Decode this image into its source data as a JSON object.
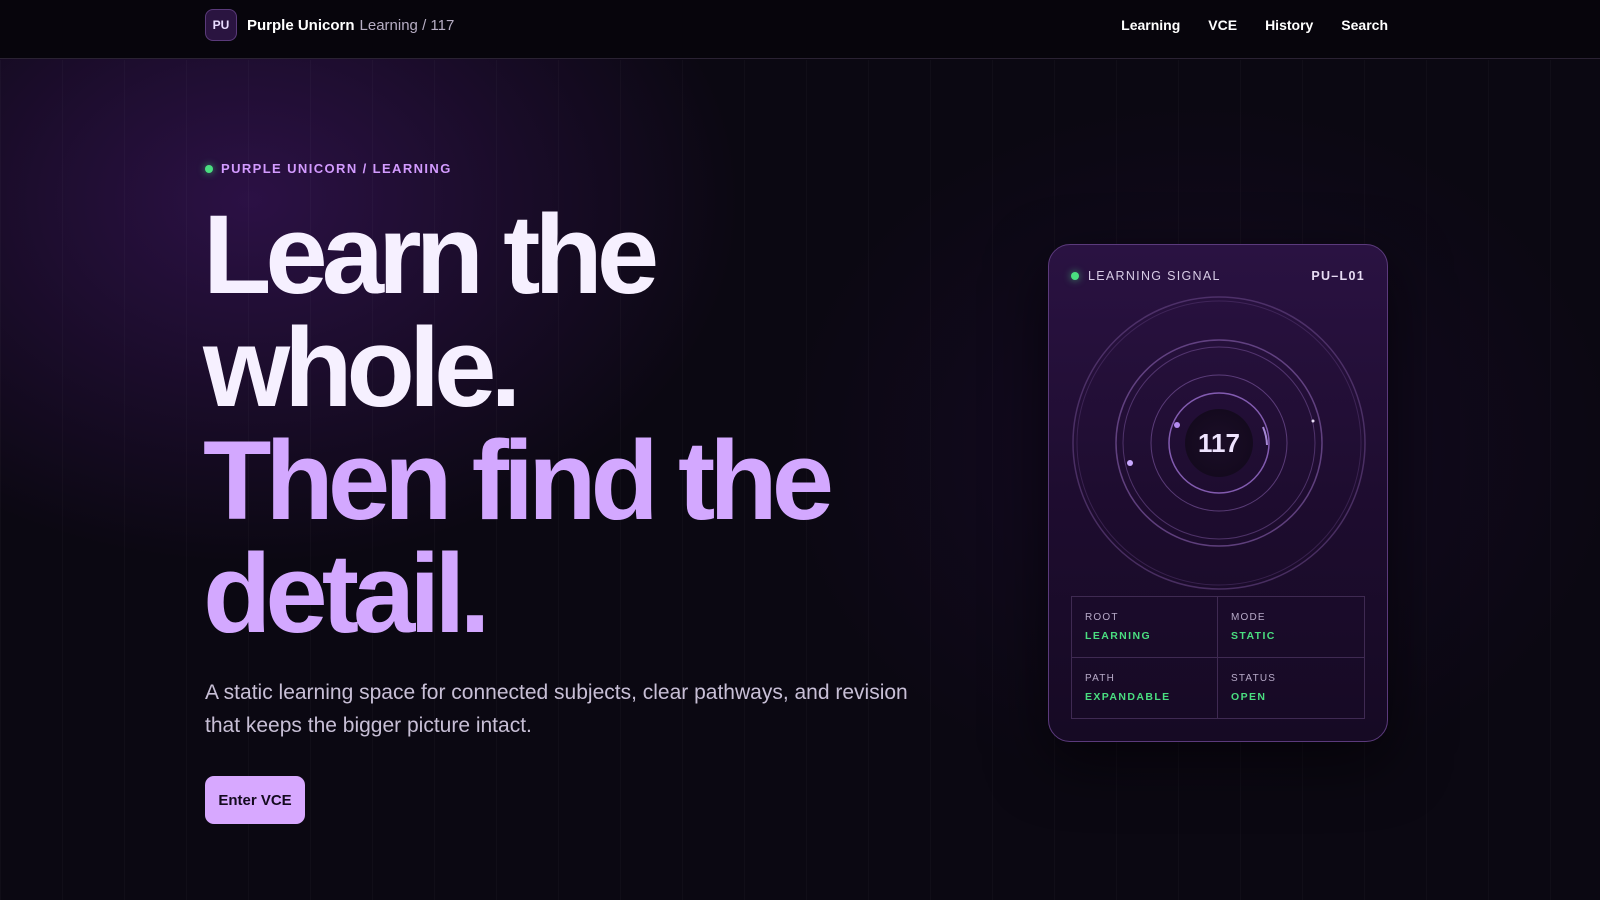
{
  "header": {
    "logo_initials": "PU",
    "brand_name": "Purple Unicorn",
    "brand_path": "Learning / 117",
    "nav": [
      {
        "label": "Learning"
      },
      {
        "label": "VCE"
      },
      {
        "label": "History"
      },
      {
        "label": "Search"
      }
    ]
  },
  "hero": {
    "eyebrow": "PURPLE UNICORN / LEARNING",
    "headline_lines": [
      "Learn the",
      "whole.",
      "Then find the",
      "detail."
    ],
    "subtitle": "A static learning space for connected subjects, clear pathways, and revision that keeps the bigger picture intact.",
    "cta_label": "Enter VCE"
  },
  "signal_card": {
    "title": "LEARNING SIGNAL",
    "code": "PU–L01",
    "number": "117",
    "stats": [
      {
        "label": "ROOT",
        "value": "LEARNING"
      },
      {
        "label": "MODE",
        "value": "STATIC"
      },
      {
        "label": "PATH",
        "value": "EXPANDABLE"
      },
      {
        "label": "STATUS",
        "value": "OPEN"
      }
    ]
  },
  "colors": {
    "background": "#0b0812",
    "accent_purple": "#d3a8ff",
    "status_green": "#4ade80",
    "card_border": "#5b3a7c"
  }
}
